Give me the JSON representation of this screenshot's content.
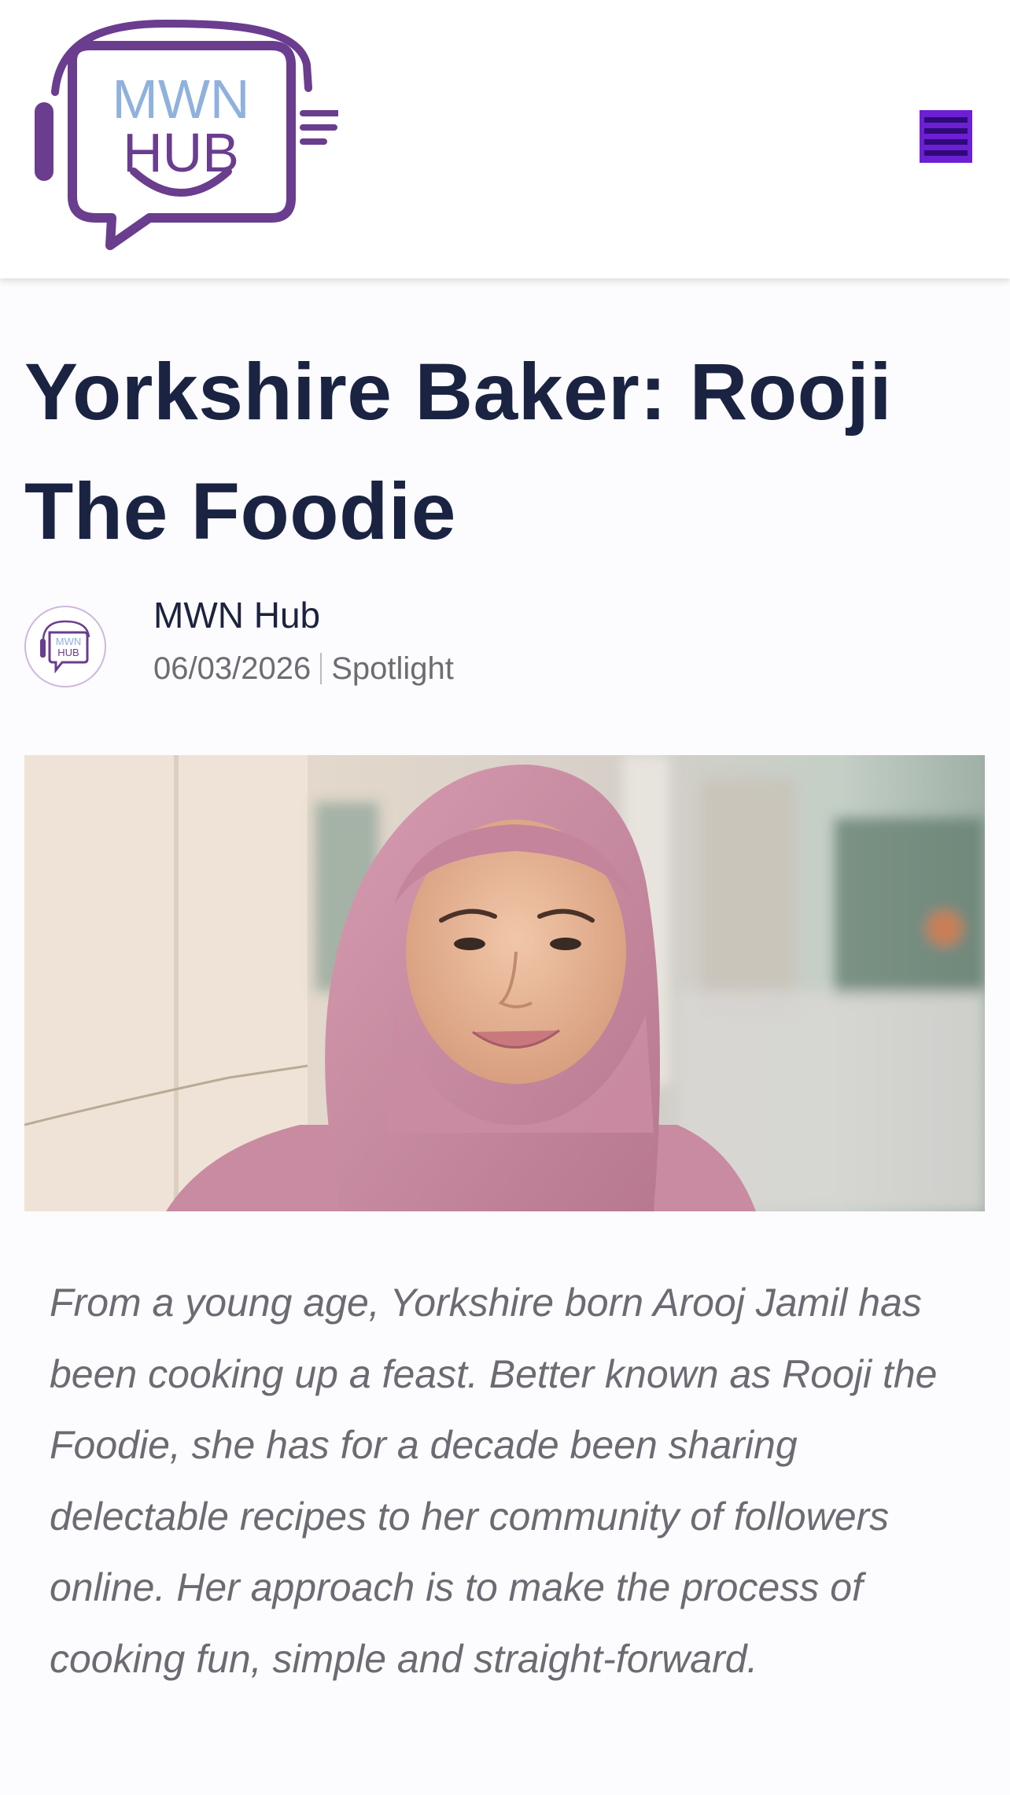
{
  "header": {
    "logo": {
      "line1": "MWN",
      "line2": "HUB"
    },
    "menu_icon": "hamburger-menu-icon"
  },
  "article": {
    "title": "Yorkshire Baker: Rooji The Foodie",
    "author": "MWN Hub",
    "date": "06/03/2026",
    "category": "Spotlight",
    "intro": "From a young age, Yorkshire born Arooj Jamil has been cooking up a feast. Better known as Rooji the Foodie, she has for a decade been sharing delectable recipes to her community of followers online. Her approach is to make the process of cooking fun, simple and straight-forward."
  },
  "colors": {
    "brand_purple": "#6a3d8f",
    "brand_blue": "#8fb1dd",
    "menu_purple": "#6d1fd4",
    "title_navy": "#1a2342"
  }
}
